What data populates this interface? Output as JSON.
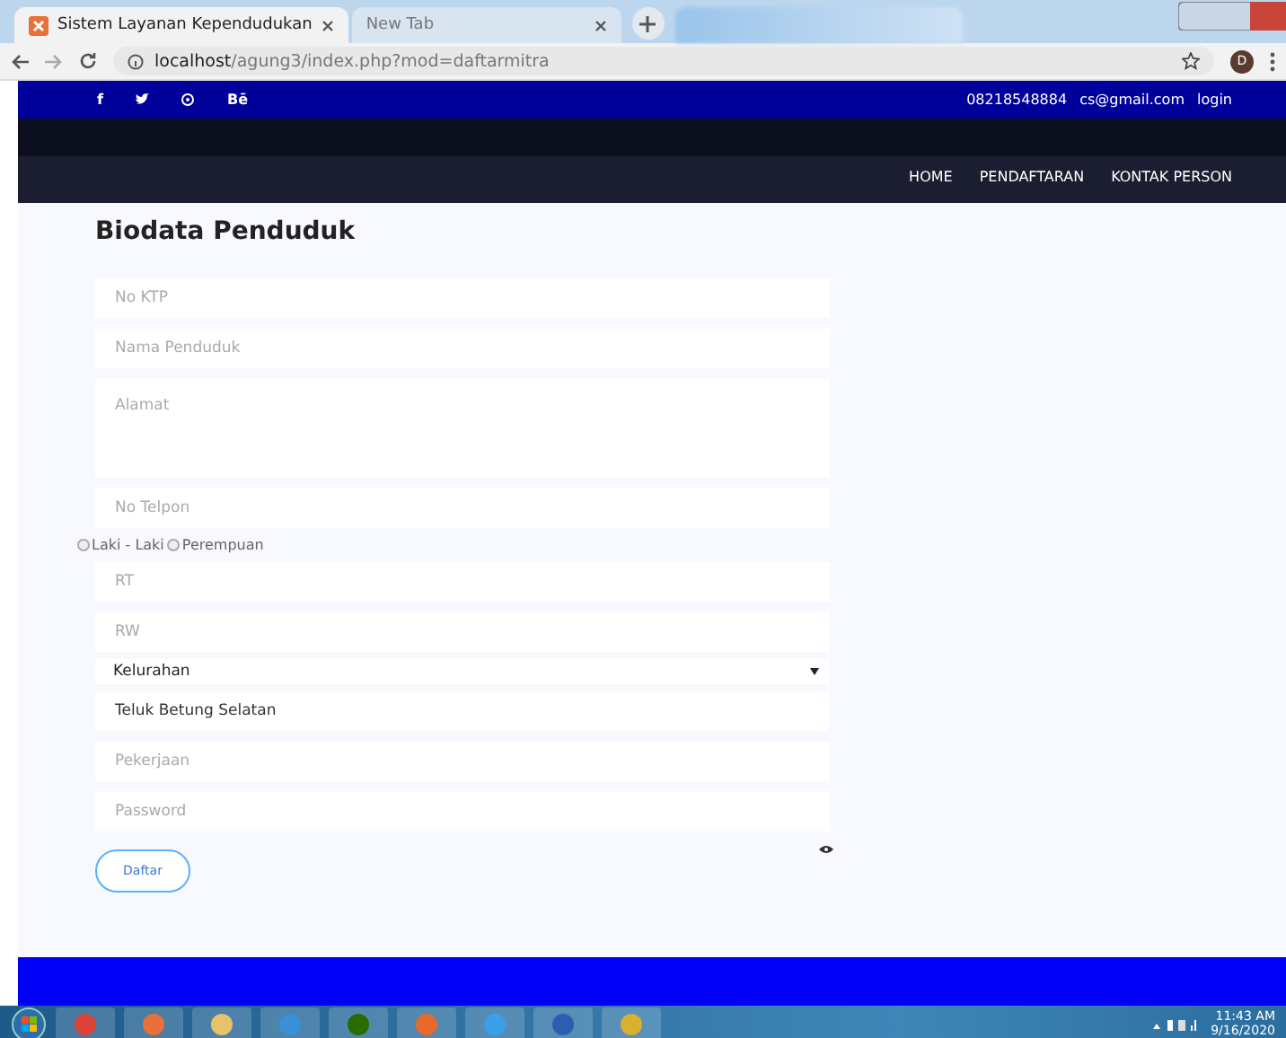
{
  "browser": {
    "tabs": [
      {
        "title": "Sistem Layanan Kependudukan",
        "selected": true
      },
      {
        "title": "New Tab",
        "selected": false
      }
    ],
    "address": {
      "host": "localhost",
      "path": "/agung3/index.php?mod=daftarmitra"
    },
    "profile_initial": "D"
  },
  "topbar": {
    "social": [
      "f",
      "Bē"
    ],
    "phone": "08218548884",
    "email": "cs@gmail.com",
    "login": "login"
  },
  "nav": [
    {
      "label": "HOME"
    },
    {
      "label": "PENDAFTARAN"
    },
    {
      "label": "KONTAK PERSON"
    }
  ],
  "form": {
    "title": "Biodata Penduduk",
    "fields": [
      {
        "kind": "input",
        "placeholder": "No KTP"
      },
      {
        "kind": "input",
        "placeholder": "Nama Penduduk"
      },
      {
        "kind": "textarea",
        "placeholder": "Alamat"
      },
      {
        "kind": "input",
        "placeholder": "No Telpon"
      },
      {
        "kind": "radio",
        "options": [
          {
            "label": "Laki - Laki",
            "selected": false
          },
          {
            "label": "Perempuan",
            "selected": false
          }
        ]
      },
      {
        "kind": "input",
        "placeholder": "RT"
      },
      {
        "kind": "input",
        "placeholder": "RW"
      },
      {
        "kind": "select",
        "value": "Kelurahan"
      },
      {
        "kind": "input",
        "value": "Teluk Betung Selatan"
      },
      {
        "kind": "input",
        "placeholder": "Pekerjaan"
      },
      {
        "kind": "password",
        "placeholder": "Password"
      }
    ],
    "submit": "Daftar"
  },
  "taskbar": {
    "time": "11:43 AM",
    "date": "9/16/2020"
  }
}
